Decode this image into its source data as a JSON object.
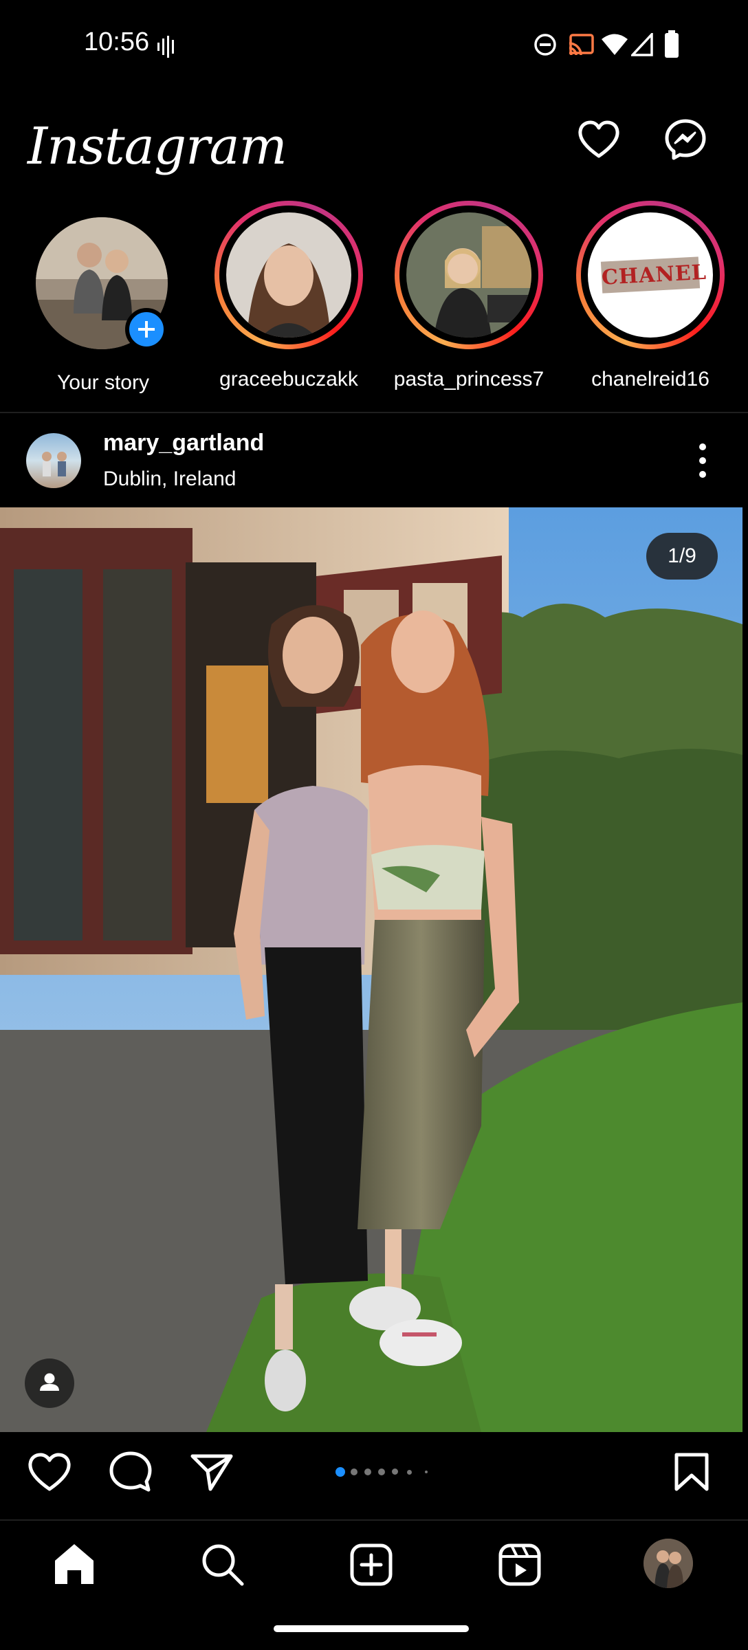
{
  "status_bar": {
    "time": "10:56"
  },
  "header": {
    "logo_text": "Instagram"
  },
  "stories": [
    {
      "name": "Your story",
      "is_own": true
    },
    {
      "name": "graceebuczakk"
    },
    {
      "name": "pasta_princess7"
    },
    {
      "name": "chanelreid16",
      "avatar_text": "CHANEL"
    }
  ],
  "post": {
    "username": "mary_gartland",
    "location": "Dublin, Ireland",
    "counter": "1/9",
    "carousel_dots": 6,
    "active_dot": 0
  },
  "colors": {
    "accent": "#1b8fff",
    "background": "#000000"
  },
  "icons": [
    "activity-heart-icon",
    "messenger-icon",
    "like-icon",
    "comment-icon",
    "share-icon",
    "bookmark-icon",
    "home-icon",
    "search-icon",
    "create-icon",
    "reels-icon",
    "profile-avatar"
  ]
}
